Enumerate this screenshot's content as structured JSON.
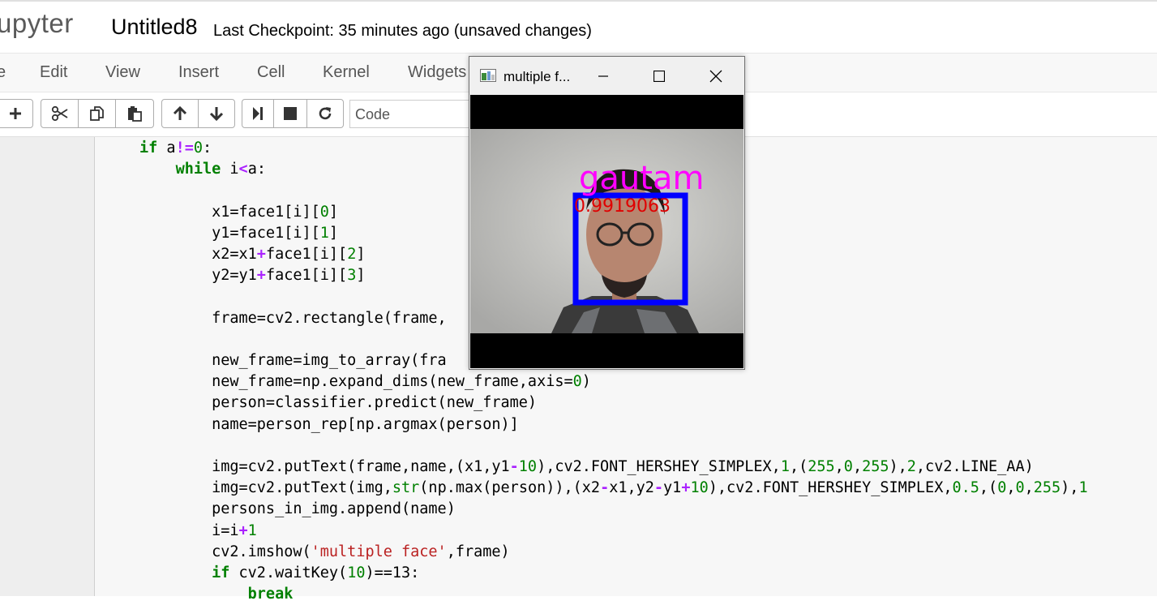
{
  "header": {
    "logo_text": "upyter",
    "notebook_name": "Untitled8",
    "checkpoint": "Last Checkpoint: 35 minutes ago (unsaved changes)"
  },
  "menu": {
    "items": [
      {
        "label": "e"
      },
      {
        "label": "Edit"
      },
      {
        "label": "View"
      },
      {
        "label": "Insert"
      },
      {
        "label": "Cell"
      },
      {
        "label": "Kernel"
      },
      {
        "label": "Widgets"
      }
    ]
  },
  "toolbar": {
    "icons": [
      "plus-icon",
      "scissors-icon",
      "copy-icon",
      "paste-icon",
      "arrow-up-icon",
      "arrow-down-icon",
      "step-forward-icon",
      "stop-icon",
      "restart-icon"
    ],
    "cell_type_value": "Code"
  },
  "code": {
    "lines": [
      [
        {
          "t": "if",
          "c": "kw"
        },
        {
          "t": " a"
        },
        {
          "t": "!=",
          "c": "op"
        },
        {
          "t": "0",
          "c": "num"
        },
        {
          "t": ":"
        }
      ],
      [
        {
          "t": "    "
        },
        {
          "t": "while",
          "c": "kw"
        },
        {
          "t": " i"
        },
        {
          "t": "<",
          "c": "op"
        },
        {
          "t": "a:"
        }
      ],
      [
        {
          "t": ""
        }
      ],
      [
        {
          "t": "        x1=face1[i]["
        },
        {
          "t": "0",
          "c": "num"
        },
        {
          "t": "]"
        }
      ],
      [
        {
          "t": "        y1=face1[i]["
        },
        {
          "t": "1",
          "c": "num"
        },
        {
          "t": "]"
        }
      ],
      [
        {
          "t": "        x2=x1"
        },
        {
          "t": "+",
          "c": "op"
        },
        {
          "t": "face1[i]["
        },
        {
          "t": "2",
          "c": "num"
        },
        {
          "t": "]"
        }
      ],
      [
        {
          "t": "        y2=y1"
        },
        {
          "t": "+",
          "c": "op"
        },
        {
          "t": "face1[i]["
        },
        {
          "t": "3",
          "c": "num"
        },
        {
          "t": "]"
        }
      ],
      [
        {
          "t": ""
        }
      ],
      [
        {
          "t": "        frame=cv2.rectangle(frame,                           )"
        }
      ],
      [
        {
          "t": ""
        }
      ],
      [
        {
          "t": "        new_frame=img_to_array(fra"
        }
      ],
      [
        {
          "t": "        new_frame=np.expand_dims(new_frame,axis="
        },
        {
          "t": "0",
          "c": "num"
        },
        {
          "t": ")"
        }
      ],
      [
        {
          "t": "        person=classifier.predict(new_frame)"
        }
      ],
      [
        {
          "t": "        name=person_rep[np.argmax(person)]"
        }
      ],
      [
        {
          "t": ""
        }
      ],
      [
        {
          "t": "        img=cv2.putText(frame,name,(x1,y1"
        },
        {
          "t": "-",
          "c": "op"
        },
        {
          "t": "10",
          "c": "num"
        },
        {
          "t": "),cv2.FONT_HERSHEY_SIMPLEX,"
        },
        {
          "t": "1",
          "c": "num"
        },
        {
          "t": ",("
        },
        {
          "t": "255",
          "c": "num"
        },
        {
          "t": ","
        },
        {
          "t": "0",
          "c": "num"
        },
        {
          "t": ","
        },
        {
          "t": "255",
          "c": "num"
        },
        {
          "t": "),"
        },
        {
          "t": "2",
          "c": "num"
        },
        {
          "t": ",cv2.LINE_AA)"
        }
      ],
      [
        {
          "t": "        img=cv2.putText(img,"
        },
        {
          "t": "str",
          "c": "bi"
        },
        {
          "t": "(np.max(person)),(x2"
        },
        {
          "t": "-",
          "c": "op"
        },
        {
          "t": "x1,y2"
        },
        {
          "t": "-",
          "c": "op"
        },
        {
          "t": "y1"
        },
        {
          "t": "+",
          "c": "op"
        },
        {
          "t": "10",
          "c": "num"
        },
        {
          "t": "),cv2.FONT_HERSHEY_SIMPLEX,"
        },
        {
          "t": "0.5",
          "c": "num"
        },
        {
          "t": ",("
        },
        {
          "t": "0",
          "c": "num"
        },
        {
          "t": ","
        },
        {
          "t": "0",
          "c": "num"
        },
        {
          "t": ","
        },
        {
          "t": "255",
          "c": "num"
        },
        {
          "t": "),"
        },
        {
          "t": "1",
          "c": "num"
        }
      ],
      [
        {
          "t": "        persons_in_img.append(name)"
        }
      ],
      [
        {
          "t": "        i=i"
        },
        {
          "t": "+",
          "c": "op"
        },
        {
          "t": "1",
          "c": "num"
        }
      ],
      [
        {
          "t": "        cv2.imshow("
        },
        {
          "t": "'multiple face'",
          "c": "str"
        },
        {
          "t": ",frame)"
        }
      ],
      [
        {
          "t": "        "
        },
        {
          "t": "if",
          "c": "kw"
        },
        {
          "t": " cv2.waitKey("
        },
        {
          "t": "10",
          "c": "num"
        },
        {
          "t": ")==13:"
        }
      ],
      [
        {
          "t": "            "
        },
        {
          "t": "break",
          "c": "kw"
        }
      ]
    ]
  },
  "cv_window": {
    "title": "multiple f...",
    "label_name": "gautam",
    "label_score": "0.9919063",
    "colors": {
      "name_text": "#ff00ff",
      "score_text": "#e00000",
      "box": "#0000ff"
    }
  }
}
